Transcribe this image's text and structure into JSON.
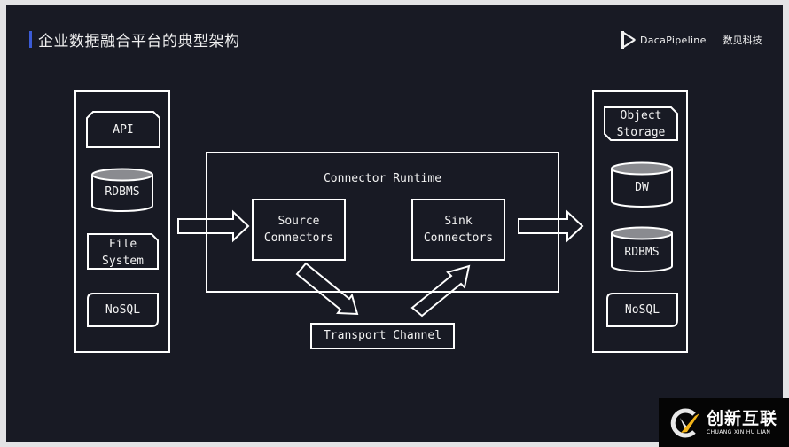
{
  "slide": {
    "title": "企业数据融合平台的典型架构",
    "accent_color": "#3b5bd6",
    "background_color": "#181a24",
    "brand": {
      "icon": "play-triangle-logo-icon",
      "name": "DacaPipeline",
      "company_cn": "数见科技"
    }
  },
  "diagram": {
    "sources": {
      "items": [
        {
          "label": "API",
          "shape": "snipped-top-corners"
        },
        {
          "label": "RDBMS",
          "shape": "cylinder"
        },
        {
          "label": "File\nSystem",
          "shape": "snipped-top-right"
        },
        {
          "label": "NoSQL",
          "shape": "rounded-diagonal"
        }
      ]
    },
    "runtime": {
      "label": "Connector Runtime",
      "source_connectors": "Source\nConnectors",
      "sink_connectors": "Sink\nConnectors"
    },
    "transport_channel": "Transport Channel",
    "targets": {
      "items": [
        {
          "label": "Object\nStorage",
          "shape": "snipped-diagonal"
        },
        {
          "label": "DW",
          "shape": "cylinder"
        },
        {
          "label": "RDBMS",
          "shape": "cylinder"
        },
        {
          "label": "NoSQL",
          "shape": "rounded-diagonal"
        }
      ]
    },
    "flow": [
      "sources -> source_connectors",
      "source_connectors -> transport_channel",
      "transport_channel -> sink_connectors",
      "sink_connectors -> targets"
    ],
    "line_color": "#ffffff",
    "cylinder_top_color": "#8a8b90"
  },
  "watermark": {
    "icon": "cx-logo-icon",
    "name_cn": "创新互联",
    "name_en": "CHUANG XIN HU LIAN"
  }
}
